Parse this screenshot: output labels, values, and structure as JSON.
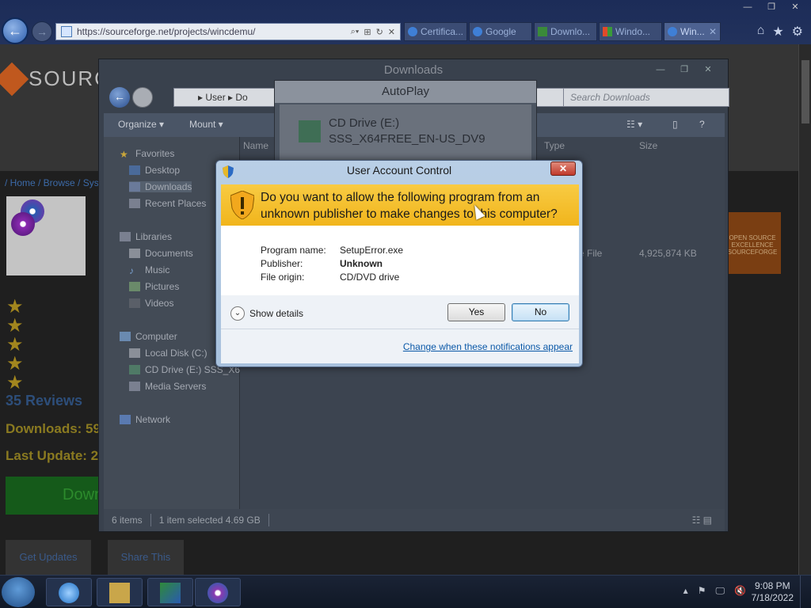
{
  "browser": {
    "url": "https://sourceforge.net/projects/wincdemu/",
    "tabs": [
      {
        "label": "Certifica...",
        "color": "#3f7fd6"
      },
      {
        "label": "Google",
        "color": "#3f7fd6"
      },
      {
        "label": "Downlo...",
        "color": "#3a8a3a"
      },
      {
        "label": "Windo...",
        "color": "#e04a2a"
      },
      {
        "label": "Win...",
        "color": "#3f7fd6",
        "active": true
      }
    ],
    "close_tab": "✕",
    "right_icons": [
      "⌂",
      "★",
      "⚙"
    ],
    "window_controls": [
      "—",
      "❐",
      "✕"
    ]
  },
  "webpage": {
    "logo_text": "SOURC",
    "breadcrumb": "/ Home / Browse / Sys",
    "reviews": "35 Reviews",
    "downloads_label": "Downloads: 59",
    "update_label": "Last Update: 2",
    "download_button": "Down",
    "button_a": "Get Updates",
    "button_b": "Share This",
    "badge_text": "OPEN SOURCE EXCELLENCE SOURCEFORGE"
  },
  "explorer": {
    "title": "Downloads",
    "path": "▸ User ▸ Do",
    "search_placeholder": "Search Downloads",
    "toolbar": {
      "organize": "Organize ▾",
      "mount": "Mount ▾"
    },
    "nav": {
      "favorites": "Favorites",
      "desktop": "Desktop",
      "downloads": "Downloads",
      "recent": "Recent Places",
      "libraries": "Libraries",
      "documents": "Documents",
      "music": "Music",
      "pictures": "Pictures",
      "videos": "Videos",
      "computer": "Computer",
      "local_disk": "Local Disk (C:)",
      "cd_drive": "CD Drive (E:) SSS_X6",
      "media_servers": "Media Servers",
      "network": "Network"
    },
    "columns": {
      "name": "Name",
      "type": "Type",
      "size": "Size"
    },
    "file_row": {
      "type": "e File",
      "size": "4,925,874 KB"
    },
    "status": {
      "items": "6 items",
      "selected": "1 item selected  4.69 GB"
    }
  },
  "autoplay": {
    "title": "AutoPlay",
    "drive_line1": "CD Drive (E:)",
    "drive_line2": "SSS_X64FREE_EN-US_DV9"
  },
  "uac": {
    "title": "User Account Control",
    "close": "✕",
    "question": "Do you want to allow the following program from an unknown publisher to make changes to this computer?",
    "program_name_label": "Program name:",
    "program_name": "SetupError.exe",
    "publisher_label": "Publisher:",
    "publisher": "Unknown",
    "origin_label": "File origin:",
    "origin": "CD/DVD drive",
    "show_details": "Show details",
    "yes": "Yes",
    "no": "No",
    "change_link": "Change when these notifications appear"
  },
  "taskbar": {
    "time": "9:08 PM",
    "date": "7/18/2022",
    "tray_icons": [
      "▴",
      "⚑",
      "🖵",
      "🔇"
    ]
  }
}
